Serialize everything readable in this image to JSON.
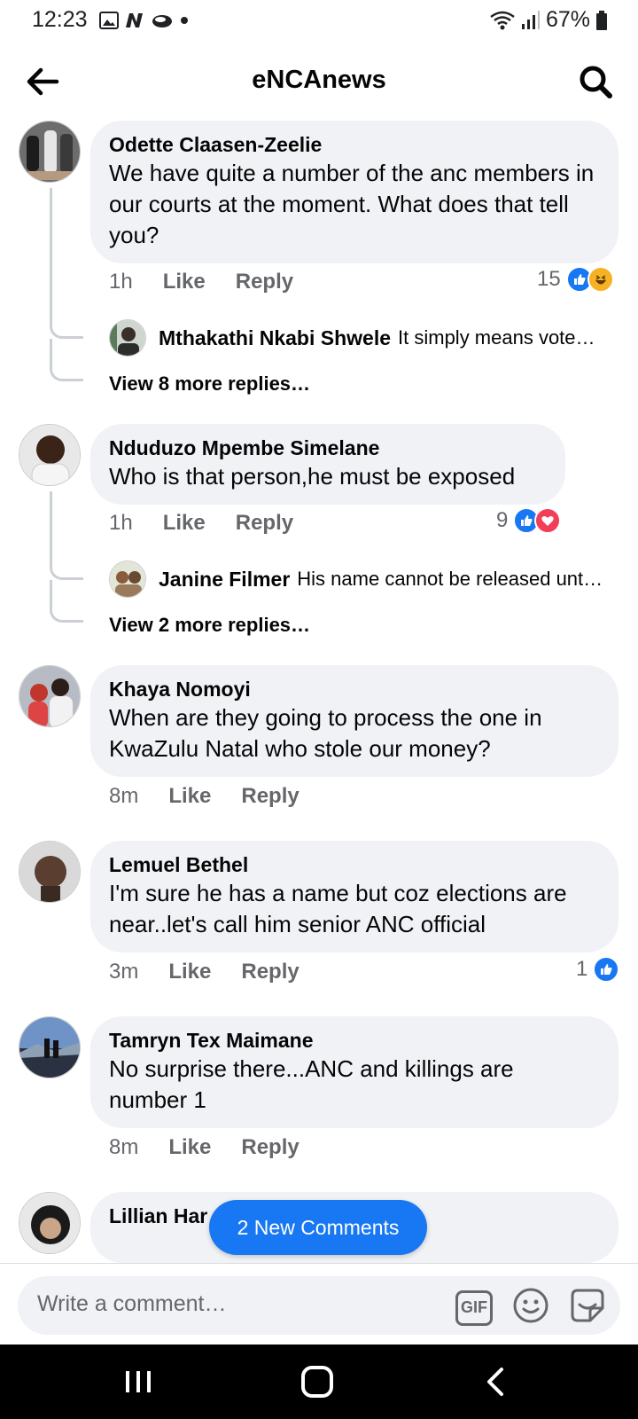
{
  "status": {
    "time": "12:23",
    "battery": "67%"
  },
  "header": {
    "title": "eNCAnews"
  },
  "comments": [
    {
      "author": "Odette Claasen-Zeelie",
      "text": "We have quite a number of the anc members in our courts at the moment.  What does that tell you?",
      "time": "1h",
      "like": "Like",
      "reply": "Reply",
      "reaction_count": "15",
      "reply_preview": {
        "author": "Mthakathi Nkabi Shwele",
        "snippet": "It simply means vote…"
      },
      "view_more": "View 8 more replies…"
    },
    {
      "author": "Nduduzo Mpembe Simelane",
      "text": "Who is that person,he must be exposed",
      "time": "1h",
      "like": "Like",
      "reply": "Reply",
      "reaction_count": "9",
      "reply_preview": {
        "author": "Janine Filmer",
        "snippet": "His name cannot be released unt…"
      },
      "view_more": "View 2 more replies…"
    },
    {
      "author": "Khaya Nomoyi",
      "text": "When are they going to process the one in KwaZulu Natal who stole our money?",
      "time": "8m",
      "like": "Like",
      "reply": "Reply"
    },
    {
      "author": "Lemuel Bethel",
      "text": "I'm sure he has a name but coz elections are near..let's call him senior ANC official",
      "time": "3m",
      "like": "Like",
      "reply": "Reply",
      "reaction_count": "1"
    },
    {
      "author": "Tamryn Tex Maimane",
      "text": "No surprise there...ANC and killings are number 1",
      "time": "8m",
      "like": "Like",
      "reply": "Reply"
    },
    {
      "author": "Lillian Har"
    }
  ],
  "new_comments_label": "2 New Comments",
  "composer": {
    "placeholder": "Write a comment…",
    "gif_label": "GIF"
  },
  "colors": {
    "accent": "#1877f2",
    "bubble": "#f0f2f5",
    "secondary_text": "#65676b",
    "love": "#f33e58",
    "haha": "#f7b125"
  },
  "icons": [
    "back-arrow-icon",
    "search-icon",
    "like-reaction-icon",
    "haha-reaction-icon",
    "love-reaction-icon",
    "gif-icon",
    "emoji-icon",
    "sticker-icon"
  ]
}
